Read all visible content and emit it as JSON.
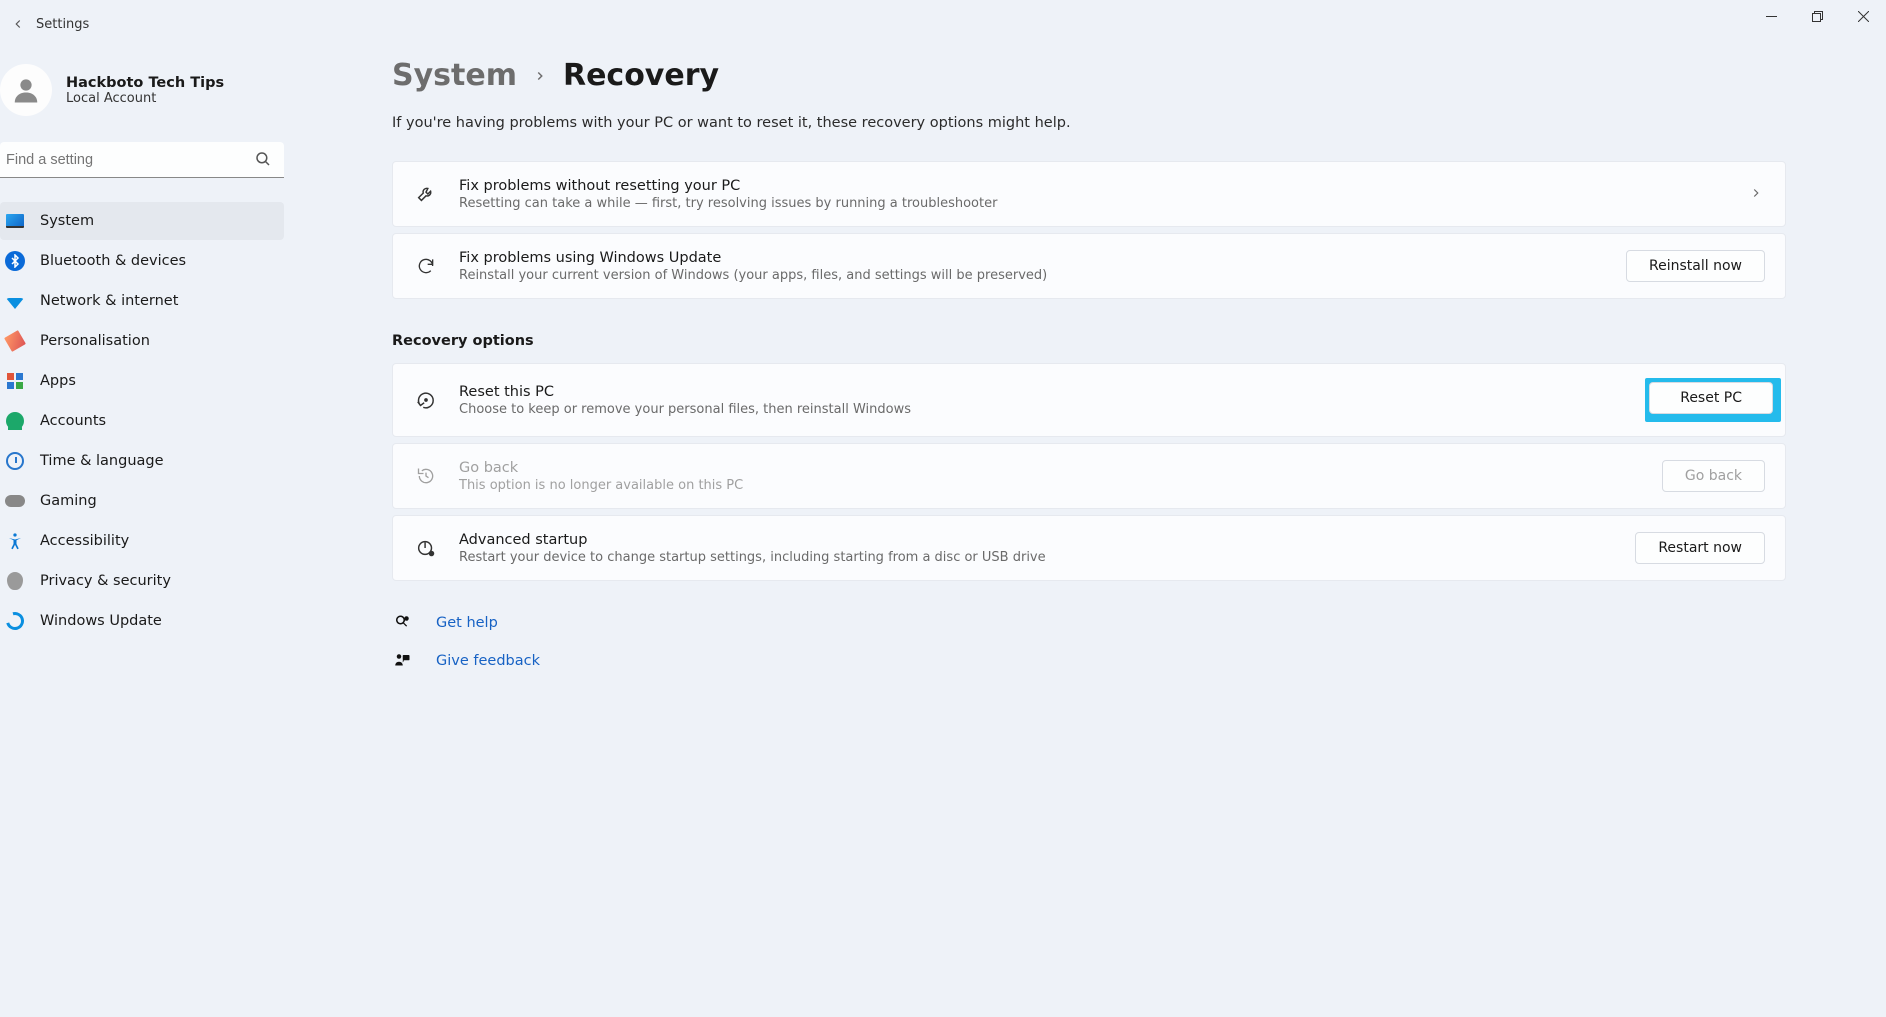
{
  "app": {
    "title": "Settings"
  },
  "user": {
    "name": "Hackboto Tech Tips",
    "subtitle": "Local Account"
  },
  "search": {
    "placeholder": "Find a setting"
  },
  "nav": {
    "items": [
      {
        "label": "System"
      },
      {
        "label": "Bluetooth & devices"
      },
      {
        "label": "Network & internet"
      },
      {
        "label": "Personalisation"
      },
      {
        "label": "Apps"
      },
      {
        "label": "Accounts"
      },
      {
        "label": "Time & language"
      },
      {
        "label": "Gaming"
      },
      {
        "label": "Accessibility"
      },
      {
        "label": "Privacy & security"
      },
      {
        "label": "Windows Update"
      }
    ]
  },
  "breadcrumb": {
    "parent": "System",
    "current": "Recovery"
  },
  "intro": "If you're having problems with your PC or want to reset it, these recovery options might help.",
  "cards_top": {
    "troubleshoot": {
      "title": "Fix problems without resetting your PC",
      "subtitle": "Resetting can take a while — first, try resolving issues by running a troubleshooter"
    },
    "winupdate": {
      "title": "Fix problems using Windows Update",
      "subtitle": "Reinstall your current version of Windows (your apps, files, and settings will be preserved)",
      "button": "Reinstall now"
    }
  },
  "section_label": "Recovery options",
  "cards_bottom": {
    "reset": {
      "title": "Reset this PC",
      "subtitle": "Choose to keep or remove your personal files, then reinstall Windows",
      "button": "Reset PC"
    },
    "goback": {
      "title": "Go back",
      "subtitle": "This option is no longer available on this PC",
      "button": "Go back"
    },
    "advanced": {
      "title": "Advanced startup",
      "subtitle": "Restart your device to change startup settings, including starting from a disc or USB drive",
      "button": "Restart now"
    }
  },
  "footer": {
    "help": "Get help",
    "feedback": "Give feedback"
  }
}
